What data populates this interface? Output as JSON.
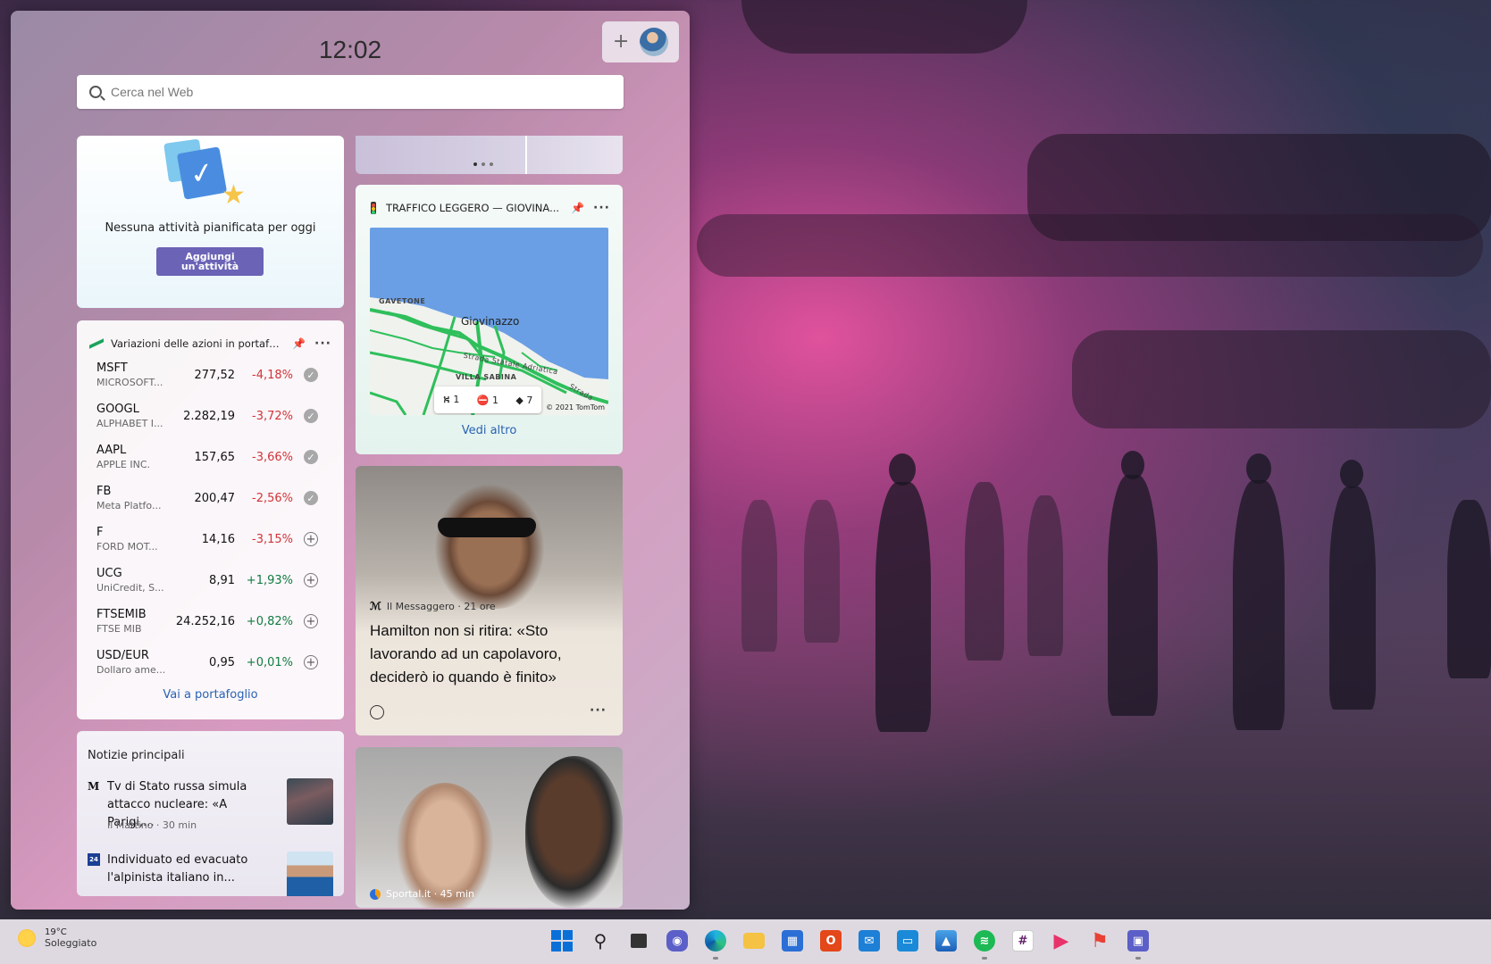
{
  "clock": {
    "time": "12:02"
  },
  "search": {
    "placeholder": "Cerca nel Web"
  },
  "tasks": {
    "empty_text": "Nessuna attività pianificata per oggi",
    "add_button": "Aggiungi un'attività"
  },
  "stocks": {
    "title": "Variazioni delle azioni in portafog...",
    "link": "Vai a portafoglio",
    "rows": [
      {
        "symbol": "MSFT",
        "name": "MICROSOFT...",
        "price": "277,52",
        "change": "-4,18%",
        "dir": "neg",
        "state": "added"
      },
      {
        "symbol": "GOOGL",
        "name": "ALPHABET I...",
        "price": "2.282,19",
        "change": "-3,72%",
        "dir": "neg",
        "state": "added"
      },
      {
        "symbol": "AAPL",
        "name": "APPLE INC.",
        "price": "157,65",
        "change": "-3,66%",
        "dir": "neg",
        "state": "added"
      },
      {
        "symbol": "FB",
        "name": "Meta Platfo...",
        "price": "200,47",
        "change": "-2,56%",
        "dir": "neg",
        "state": "added"
      },
      {
        "symbol": "F",
        "name": "FORD MOT...",
        "price": "14,16",
        "change": "-3,15%",
        "dir": "neg",
        "state": "add"
      },
      {
        "symbol": "UCG",
        "name": "UniCredit, S...",
        "price": "8,91",
        "change": "+1,93%",
        "dir": "pos",
        "state": "add"
      },
      {
        "symbol": "FTSEMIB",
        "name": "FTSE MIB",
        "price": "24.252,16",
        "change": "+0,82%",
        "dir": "pos",
        "state": "add"
      },
      {
        "symbol": "USD/EUR",
        "name": "Dollaro ame...",
        "price": "0,95",
        "change": "+0,01%",
        "dir": "pos",
        "state": "add"
      }
    ]
  },
  "top_news": {
    "title": "Notizie principali",
    "items": [
      {
        "logo": "M",
        "headline": "Tv di Stato russa simula attacco nucleare: «A Parigi,...",
        "meta": "Il Mattino · 30 min"
      },
      {
        "logo": "24",
        "headline": "Individuato ed evacuato l'alpinista italiano in...",
        "meta": ""
      }
    ]
  },
  "traffic": {
    "title": "TRAFFICO LEGGERO — GIOVINA...",
    "map": {
      "labels": [
        "GAVETONE",
        "Giovinazzo",
        "Strada Statale Adriatica",
        "VILLA SABINA",
        "Strada"
      ],
      "incidents": {
        "closures": "1",
        "blocked": "1",
        "works": "7"
      },
      "copyright": "© 2021 TomTom"
    },
    "link": "Vedi altro"
  },
  "article": {
    "source": "Il Messaggero · 21 ore",
    "title": "Hamilton non si ritira: «Sto lavorando ad un capolavoro, deciderò io quando è finito»"
  },
  "article2": {
    "source": "Sportal.it · 45 min"
  },
  "taskbar": {
    "weather_temp": "19°C",
    "weather_desc": "Soleggiato"
  },
  "colors": {
    "accent": "#6b63b6",
    "link": "#2862b3",
    "negative": "#d13438",
    "positive": "#107c41"
  }
}
